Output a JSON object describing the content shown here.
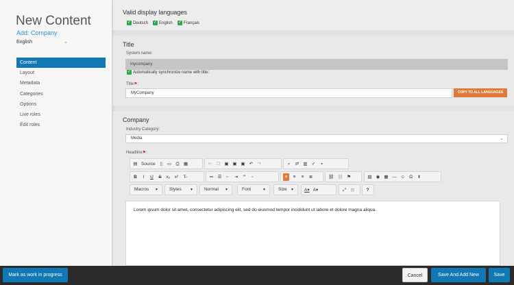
{
  "sidebar": {
    "title": "New Content",
    "subtitle": "Add: Company",
    "language": "English",
    "nav": [
      "Content",
      "Layout",
      "Metadata",
      "Categories",
      "Options",
      "Live roles",
      "Edit roles"
    ]
  },
  "languages": {
    "heading": "Valid display languages",
    "items": [
      "Deutsch",
      "English",
      "Français"
    ]
  },
  "title_section": {
    "heading": "Title",
    "system_name_label": "System name:",
    "system_name_value": "mycompany",
    "sync_label": "Automatically synchronize name with title:",
    "title_label": "Title",
    "title_value": "MyCompany",
    "copy_button": "COPY TO ALL LANGUAGES"
  },
  "company_section": {
    "heading": "Company",
    "industry_label": "Industry Category:",
    "industry_value": "Media",
    "headline_label": "Headline",
    "toolbar": {
      "source": "Source",
      "macros": "Macros",
      "styles": "Styles",
      "format": "Normal",
      "font": "Font",
      "size": "Size"
    },
    "body_text": "Lorem ipsum dolor sit amet, consectetur adipiscing elit, sed do eiusmod tempor incididunt ut labore et dolore magna aliqua."
  },
  "bottom": {
    "wip": "Mark as work in progress",
    "cancel": "Cancel",
    "save_add": "Save And Add New",
    "save": "Save"
  },
  "colors": {
    "accent": "#1178b4",
    "orange": "#e07a3a",
    "check": "#2ea84c"
  }
}
